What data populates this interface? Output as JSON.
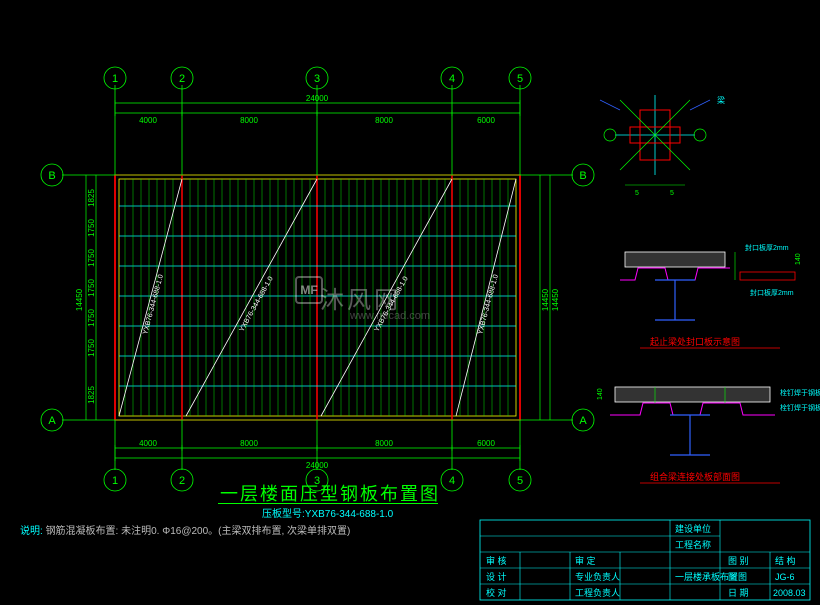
{
  "title": "一层楼面压型钢板布置图",
  "subtitle_label": "压板型号:",
  "subtitle_value": "YXB76-344-688-1.0",
  "note_label": "说明:",
  "note_text": "钢筋混凝板布置: 未注明0. Φ16@200。(主梁双排布置, 次梁单排双置)",
  "watermark": "沐风网",
  "watermark_url": "www.mfcad.com",
  "grid": {
    "cols": [
      "1",
      "2",
      "3",
      "4",
      "5"
    ],
    "rows": [
      "A",
      "B"
    ],
    "total_width": "24000",
    "spans": [
      "4000",
      "8000",
      "8000",
      "6000"
    ],
    "height_total": "14450",
    "row_dims": [
      "1825",
      "1750",
      "1750",
      "1750",
      "1750",
      "1750",
      "1825"
    ],
    "diag_label": "YXB76-344-688-1.0"
  },
  "details": {
    "d1_title": "起止梁处封口板示意图",
    "d2_title": "组合梁连接处板部面图",
    "d1_label1": "封口板厚2mm",
    "d2_label1": "栓钉焊于钢板上",
    "d2_label2": "栓钉焊于钢板上",
    "dim_140_1": "140",
    "dim_140_2": "140",
    "detail_top_label": "梁"
  },
  "titleblock": {
    "row1_l": "建设单位",
    "row2_l": "工程名称",
    "row3_l": "审 核",
    "row3_r": "审 定",
    "row4_l": "设 计",
    "row4_r": "专业负责人",
    "row5_l": "校 对",
    "row5_r": "工程负责人",
    "col_r_top": "图 别",
    "col_r_top_val": "结 构",
    "dwg_title": "一层楼承板布置图",
    "dwg_no_label": "JG-6",
    "dwg_no_prefix": "图",
    "date_label": "日 期",
    "date_val": "2008.03"
  },
  "chart_data": {
    "type": "diagram",
    "plan": {
      "grid_x": {
        "labels": [
          "1",
          "2",
          "3",
          "4",
          "5"
        ],
        "spacing_mm": [
          4000,
          8000,
          8000,
          6000
        ],
        "total_mm": 24000
      },
      "grid_y": {
        "labels": [
          "A",
          "B"
        ],
        "sub_spacing_mm": [
          1825,
          1750,
          1750,
          1750,
          1750,
          1750,
          1825
        ],
        "total_mm": 14450
      },
      "deck_type": "YXB76-344-688-1.0",
      "description": "一层楼面压型钢板布置图"
    },
    "details": [
      {
        "name": "起止梁处封口板示意图",
        "notes": [
          "封口板厚2mm",
          "140"
        ]
      },
      {
        "name": "组合梁连接处板部面图",
        "notes": [
          "栓钉焊于钢板上",
          "140"
        ]
      }
    ]
  }
}
